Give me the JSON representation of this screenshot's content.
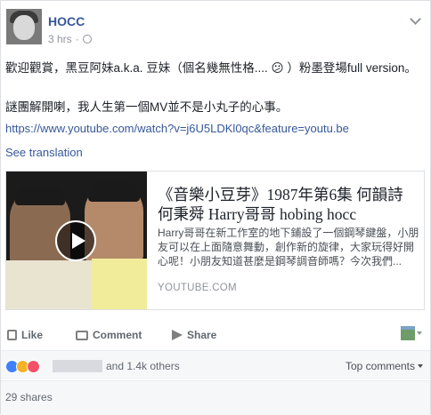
{
  "post": {
    "author": "HOCC",
    "time": "3 hrs",
    "privacy_icon": "globe-icon",
    "text_line1": "歡迎觀賞，黑豆阿妹a.k.a. 豆妹（個名幾無性格.... 😕 ）粉墨登場full version。",
    "text_line2": "謎團解開喇，我人生第一個MV並不是小丸子的心事。",
    "link": "https://www.youtube.com/watch?v=j6U5LDKl0qc&feature=youtu.be",
    "see_translation": "See translation"
  },
  "card": {
    "title": "《音樂小豆芽》1987年第6集 何韻詩 何秉舜 Harry哥哥 hobing hocc",
    "description": "Harry哥哥在新工作室的地下鋪設了一個鋼琴鍵盤，小朋友可以在上面隨意舞動，創作新的旋律，大家玩得好開心呢！小朋友知道甚麼是鋼琴調音師嗎？今次我們...",
    "domain": "YOUTUBE.COM"
  },
  "actions": {
    "like": "Like",
    "comment": "Comment",
    "share": "Share"
  },
  "reactions": {
    "others_text": "and 1.4k others",
    "top_comments": "Top comments"
  },
  "shares": "29 shares",
  "colors": {
    "link_blue": "#365899",
    "like_blue": "#4080ff",
    "haha_yellow": "#f7b125",
    "love_red": "#f25268"
  }
}
